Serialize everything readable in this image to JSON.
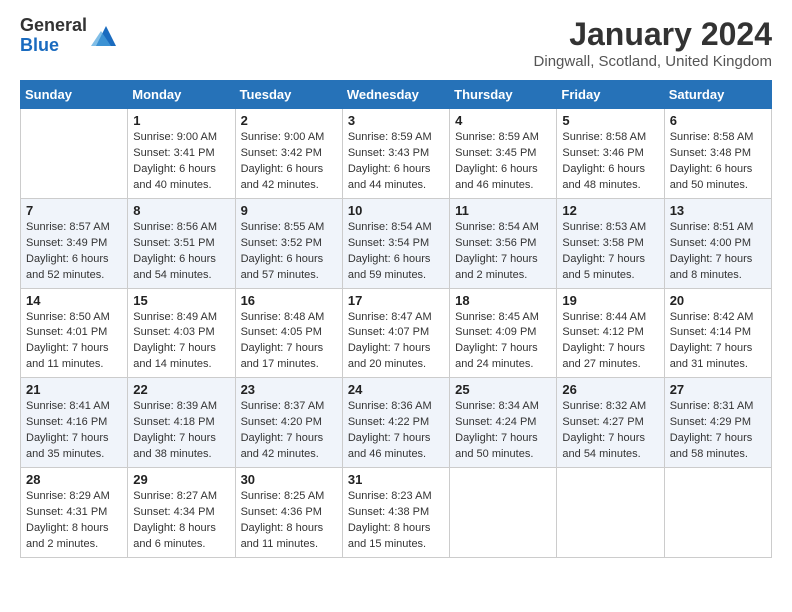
{
  "header": {
    "title": "January 2024",
    "location": "Dingwall, Scotland, United Kingdom",
    "logo_general": "General",
    "logo_blue": "Blue"
  },
  "weekdays": [
    "Sunday",
    "Monday",
    "Tuesday",
    "Wednesday",
    "Thursday",
    "Friday",
    "Saturday"
  ],
  "weeks": [
    [
      {
        "day": "",
        "info": ""
      },
      {
        "day": "1",
        "info": "Sunrise: 9:00 AM\nSunset: 3:41 PM\nDaylight: 6 hours\nand 40 minutes."
      },
      {
        "day": "2",
        "info": "Sunrise: 9:00 AM\nSunset: 3:42 PM\nDaylight: 6 hours\nand 42 minutes."
      },
      {
        "day": "3",
        "info": "Sunrise: 8:59 AM\nSunset: 3:43 PM\nDaylight: 6 hours\nand 44 minutes."
      },
      {
        "day": "4",
        "info": "Sunrise: 8:59 AM\nSunset: 3:45 PM\nDaylight: 6 hours\nand 46 minutes."
      },
      {
        "day": "5",
        "info": "Sunrise: 8:58 AM\nSunset: 3:46 PM\nDaylight: 6 hours\nand 48 minutes."
      },
      {
        "day": "6",
        "info": "Sunrise: 8:58 AM\nSunset: 3:48 PM\nDaylight: 6 hours\nand 50 minutes."
      }
    ],
    [
      {
        "day": "7",
        "info": "Sunrise: 8:57 AM\nSunset: 3:49 PM\nDaylight: 6 hours\nand 52 minutes."
      },
      {
        "day": "8",
        "info": "Sunrise: 8:56 AM\nSunset: 3:51 PM\nDaylight: 6 hours\nand 54 minutes."
      },
      {
        "day": "9",
        "info": "Sunrise: 8:55 AM\nSunset: 3:52 PM\nDaylight: 6 hours\nand 57 minutes."
      },
      {
        "day": "10",
        "info": "Sunrise: 8:54 AM\nSunset: 3:54 PM\nDaylight: 6 hours\nand 59 minutes."
      },
      {
        "day": "11",
        "info": "Sunrise: 8:54 AM\nSunset: 3:56 PM\nDaylight: 7 hours\nand 2 minutes."
      },
      {
        "day": "12",
        "info": "Sunrise: 8:53 AM\nSunset: 3:58 PM\nDaylight: 7 hours\nand 5 minutes."
      },
      {
        "day": "13",
        "info": "Sunrise: 8:51 AM\nSunset: 4:00 PM\nDaylight: 7 hours\nand 8 minutes."
      }
    ],
    [
      {
        "day": "14",
        "info": "Sunrise: 8:50 AM\nSunset: 4:01 PM\nDaylight: 7 hours\nand 11 minutes."
      },
      {
        "day": "15",
        "info": "Sunrise: 8:49 AM\nSunset: 4:03 PM\nDaylight: 7 hours\nand 14 minutes."
      },
      {
        "day": "16",
        "info": "Sunrise: 8:48 AM\nSunset: 4:05 PM\nDaylight: 7 hours\nand 17 minutes."
      },
      {
        "day": "17",
        "info": "Sunrise: 8:47 AM\nSunset: 4:07 PM\nDaylight: 7 hours\nand 20 minutes."
      },
      {
        "day": "18",
        "info": "Sunrise: 8:45 AM\nSunset: 4:09 PM\nDaylight: 7 hours\nand 24 minutes."
      },
      {
        "day": "19",
        "info": "Sunrise: 8:44 AM\nSunset: 4:12 PM\nDaylight: 7 hours\nand 27 minutes."
      },
      {
        "day": "20",
        "info": "Sunrise: 8:42 AM\nSunset: 4:14 PM\nDaylight: 7 hours\nand 31 minutes."
      }
    ],
    [
      {
        "day": "21",
        "info": "Sunrise: 8:41 AM\nSunset: 4:16 PM\nDaylight: 7 hours\nand 35 minutes."
      },
      {
        "day": "22",
        "info": "Sunrise: 8:39 AM\nSunset: 4:18 PM\nDaylight: 7 hours\nand 38 minutes."
      },
      {
        "day": "23",
        "info": "Sunrise: 8:37 AM\nSunset: 4:20 PM\nDaylight: 7 hours\nand 42 minutes."
      },
      {
        "day": "24",
        "info": "Sunrise: 8:36 AM\nSunset: 4:22 PM\nDaylight: 7 hours\nand 46 minutes."
      },
      {
        "day": "25",
        "info": "Sunrise: 8:34 AM\nSunset: 4:24 PM\nDaylight: 7 hours\nand 50 minutes."
      },
      {
        "day": "26",
        "info": "Sunrise: 8:32 AM\nSunset: 4:27 PM\nDaylight: 7 hours\nand 54 minutes."
      },
      {
        "day": "27",
        "info": "Sunrise: 8:31 AM\nSunset: 4:29 PM\nDaylight: 7 hours\nand 58 minutes."
      }
    ],
    [
      {
        "day": "28",
        "info": "Sunrise: 8:29 AM\nSunset: 4:31 PM\nDaylight: 8 hours\nand 2 minutes."
      },
      {
        "day": "29",
        "info": "Sunrise: 8:27 AM\nSunset: 4:34 PM\nDaylight: 8 hours\nand 6 minutes."
      },
      {
        "day": "30",
        "info": "Sunrise: 8:25 AM\nSunset: 4:36 PM\nDaylight: 8 hours\nand 11 minutes."
      },
      {
        "day": "31",
        "info": "Sunrise: 8:23 AM\nSunset: 4:38 PM\nDaylight: 8 hours\nand 15 minutes."
      },
      {
        "day": "",
        "info": ""
      },
      {
        "day": "",
        "info": ""
      },
      {
        "day": "",
        "info": ""
      }
    ]
  ]
}
